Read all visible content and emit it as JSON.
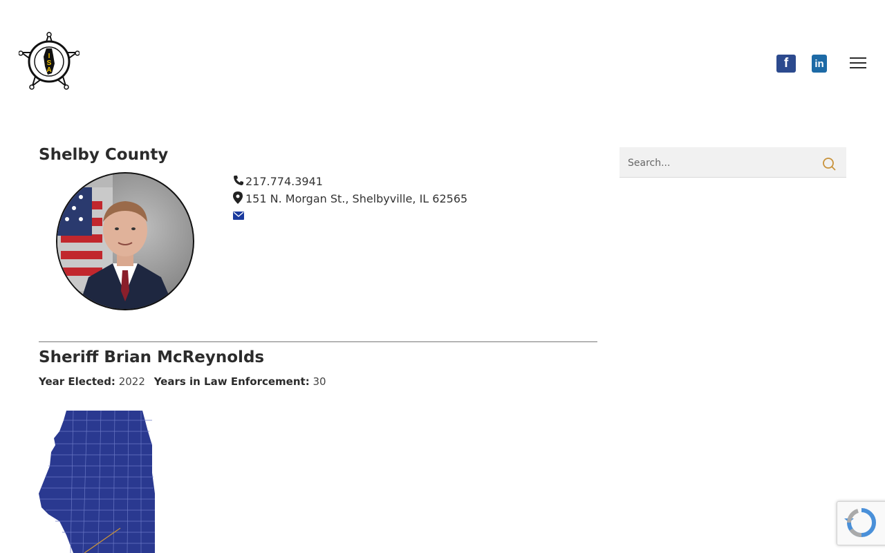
{
  "header": {
    "logo_text": "ILLINOIS SHERIFFS' ASSOCIATION",
    "logo_initials": "ISA",
    "social": [
      {
        "name": "facebook",
        "glyph": "f",
        "color": "#2c4a8e"
      },
      {
        "name": "linkedin",
        "glyph": "in",
        "color": "#1d6aa6"
      }
    ]
  },
  "county": {
    "title": "Shelby County",
    "phone": "217.774.3941",
    "address": "151 N. Morgan St., Shelbyville, IL 62565"
  },
  "sheriff": {
    "name": "Sheriff Brian McReynolds",
    "year_elected_label": "Year Elected:",
    "year_elected": "2022",
    "years_le_label": "Years in Law Enforcement:",
    "years_le": "30"
  },
  "search": {
    "placeholder": "Search..."
  },
  "colors": {
    "map_fill": "#2a3990",
    "accent_orange": "#c8923a",
    "link_blue": "#1a3a9e"
  }
}
